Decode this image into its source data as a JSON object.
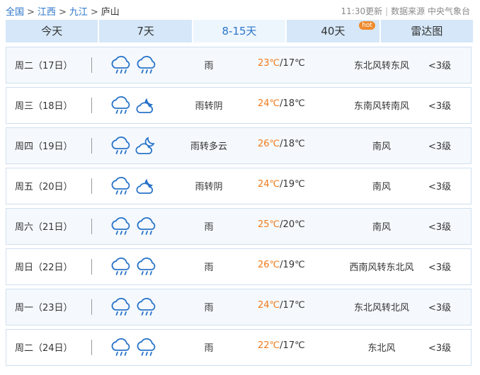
{
  "breadcrumb": [
    "全国",
    "江西",
    "九江",
    "庐山"
  ],
  "breadcrumb_sep": ">",
  "update_time": "11:30更新",
  "source": "数据来源 中央气象台",
  "meta_divider": "|",
  "tabs": [
    {
      "label": "今天",
      "active": false
    },
    {
      "label": "7天",
      "active": false
    },
    {
      "label": "8-15天",
      "active": true
    },
    {
      "label": "40天",
      "active": false,
      "badge": "hot"
    },
    {
      "label": "雷达图",
      "active": false
    }
  ],
  "icon_colors": {
    "rain": "#2a74c9",
    "cloud": "#2a74c9"
  },
  "days": [
    {
      "day": "周二（17日）",
      "icons": [
        "rain-cloud-icon",
        "rain-cloud-icon"
      ],
      "condition": "雨",
      "high": "23℃",
      "low": "17℃",
      "wind": "东北风转东风",
      "level": "<3级"
    },
    {
      "day": "周三（18日）",
      "icons": [
        "rain-cloud-icon",
        "cloudy-night-icon"
      ],
      "condition": "雨转阴",
      "high": "24℃",
      "low": "18℃",
      "wind": "东南风转南风",
      "level": "<3级"
    },
    {
      "day": "周四（19日）",
      "icons": [
        "rain-cloud-icon",
        "partly-cloudy-night-icon"
      ],
      "condition": "雨转多云",
      "high": "26℃",
      "low": "18℃",
      "wind": "南风",
      "level": "<3级"
    },
    {
      "day": "周五（20日）",
      "icons": [
        "rain-cloud-icon",
        "cloudy-night-icon"
      ],
      "condition": "雨转阴",
      "high": "24℃",
      "low": "19℃",
      "wind": "南风",
      "level": "<3级"
    },
    {
      "day": "周六（21日）",
      "icons": [
        "rain-cloud-icon",
        "rain-cloud-icon"
      ],
      "condition": "雨",
      "high": "25℃",
      "low": "20℃",
      "wind": "南风",
      "level": "<3级"
    },
    {
      "day": "周日（22日）",
      "icons": [
        "rain-cloud-icon",
        "rain-cloud-icon"
      ],
      "condition": "雨",
      "high": "26℃",
      "low": "19℃",
      "wind": "西南风转东北风",
      "level": "<3级"
    },
    {
      "day": "周一（23日）",
      "icons": [
        "rain-cloud-icon",
        "rain-cloud-icon"
      ],
      "condition": "雨",
      "high": "24℃",
      "low": "17℃",
      "wind": "东北风转北风",
      "level": "<3级"
    },
    {
      "day": "周二（24日）",
      "icons": [
        "rain-cloud-icon",
        "rain-cloud-icon"
      ],
      "condition": "雨",
      "high": "22℃",
      "low": "17℃",
      "wind": "东北风",
      "level": "<3级"
    }
  ]
}
